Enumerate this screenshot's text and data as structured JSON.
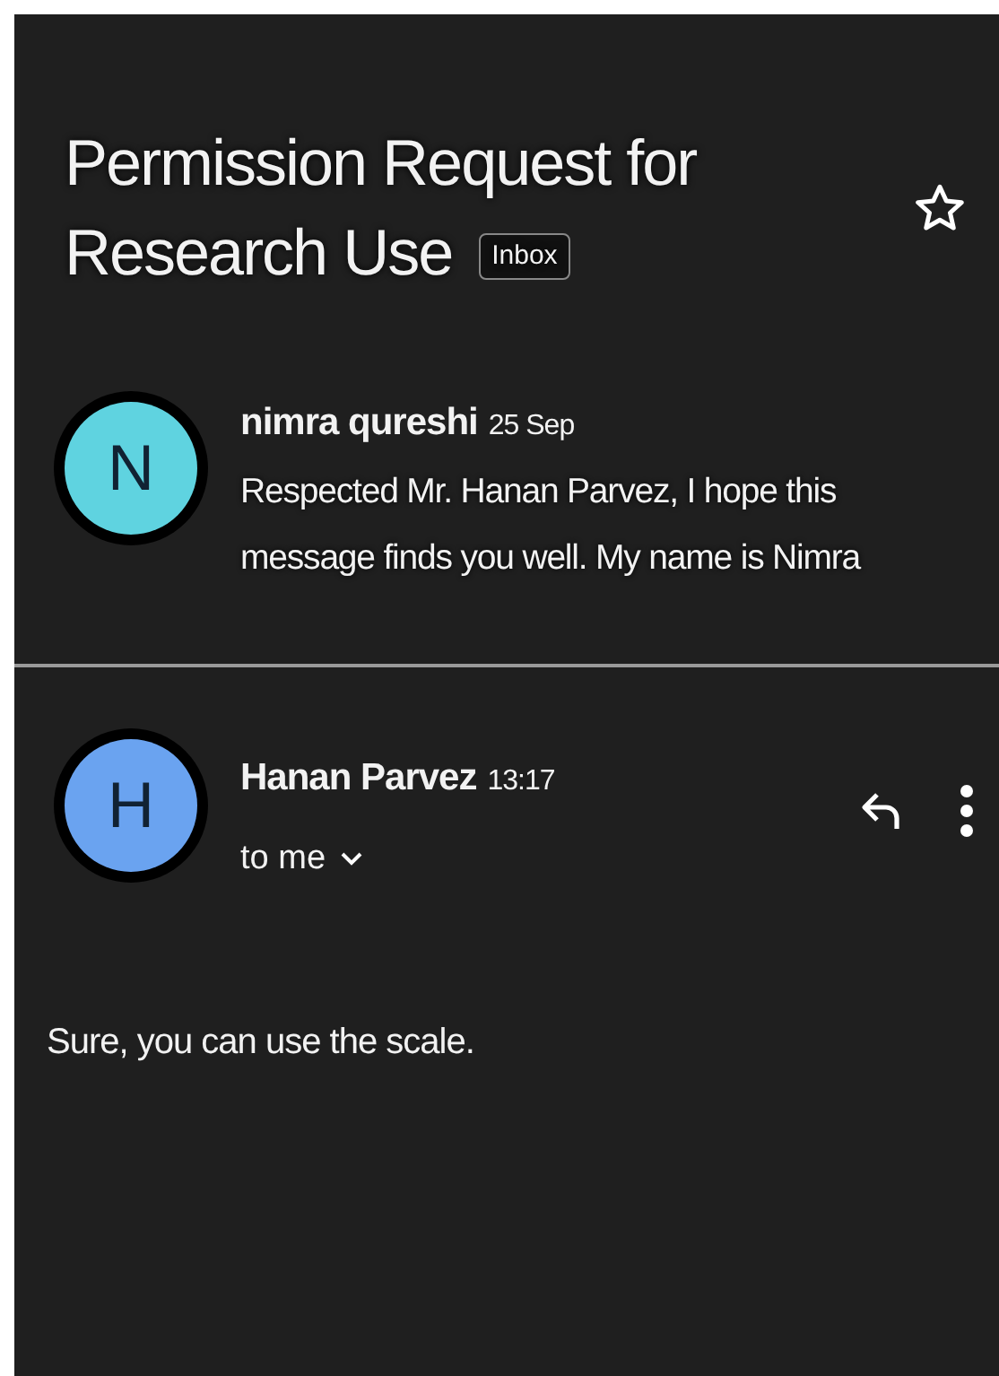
{
  "subject_lines": [
    "Permission Request for",
    "Research Use"
  ],
  "label": "Inbox",
  "starred": false,
  "messages": [
    {
      "kind": "collapsed",
      "initial": "N",
      "color": "#5fd3e0",
      "sender": "nimra qureshi",
      "time": "25 Sep",
      "snippet": "Respected Mr. Hanan Parvez, I hope this message finds you well. My name is Nimra"
    },
    {
      "kind": "expanded",
      "initial": "H",
      "color": "#6aa3f0",
      "sender": "Hanan Parvez",
      "time": "13:17",
      "recipient": "to me",
      "body": "Sure, you can use the scale."
    }
  ]
}
